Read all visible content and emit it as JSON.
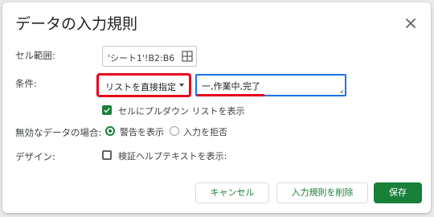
{
  "dialog": {
    "title": "データの入力規則",
    "close_icon": "close-icon"
  },
  "range": {
    "label": "セル範囲:",
    "value": "'シート1'!B2:B6",
    "grid_icon": "grid-select-icon"
  },
  "criteria": {
    "label": "条件:",
    "type_value": "リストを直接指定",
    "list_value": "一,作業中,完了"
  },
  "dropdown_checkbox": {
    "checked": true,
    "label": "セルにプルダウン リストを表示"
  },
  "invalid": {
    "label": "無効なデータの場合:",
    "options": [
      {
        "label": "警告を表示",
        "selected": true
      },
      {
        "label": "入力を拒否",
        "selected": false
      }
    ]
  },
  "design": {
    "label": "デザイン:",
    "help_checkbox_label": "検証ヘルプテキストを表示:",
    "checked": false
  },
  "buttons": {
    "cancel": "キャンセル",
    "remove": "入力規則を削除",
    "save": "保存"
  },
  "colors": {
    "accent_green": "#188038",
    "focus_blue": "#1a73e8",
    "highlight_red": "#e8001c"
  }
}
